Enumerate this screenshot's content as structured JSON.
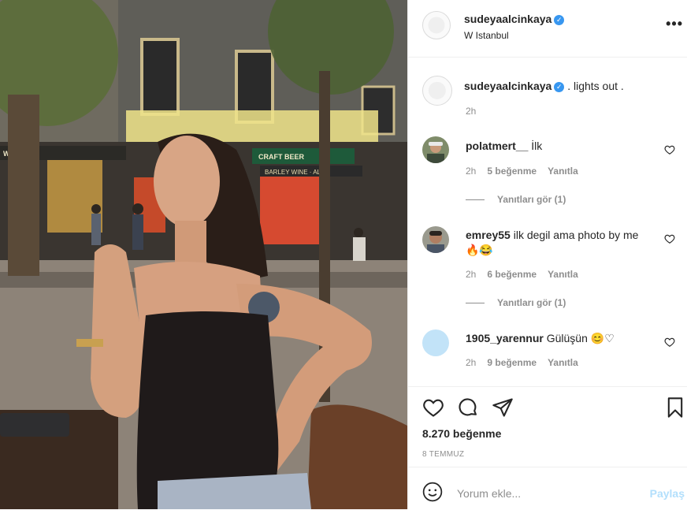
{
  "post": {
    "username": "sudeyaalcinkaya",
    "location": "W Istanbul",
    "verified_icon": "verified-badge-icon",
    "more_icon": "more-options-icon",
    "more_label": "•••"
  },
  "caption": {
    "username": "sudeyaalcinkaya",
    "text": ". lights out .",
    "time": "2h"
  },
  "photo_signs": {
    "sign1": "WEIZEN",
    "sign2": "CRAFT BEER",
    "sign3": "BARLEY WINE · ALE"
  },
  "comments": [
    {
      "username": "polatmert__",
      "text": "İlk",
      "time": "2h",
      "likes": "5 beğenme",
      "reply": "Yanıtla",
      "view_replies": "Yanıtları gör (1)"
    },
    {
      "username": "emrey55",
      "text": "ilk degil ama photo by me 🔥😂",
      "time": "2h",
      "likes": "6 beğenme",
      "reply": "Yanıtla",
      "view_replies": "Yanıtları gör (1)"
    },
    {
      "username": "1905_yarennur",
      "text": "Gülüşün 😊♡",
      "time": "2h",
      "likes": "9 beğenme",
      "reply": "Yanıtla"
    }
  ],
  "actions": {
    "likes": "8.270 beğenme",
    "date": "8 TEMMUZ",
    "icons": [
      "heart-icon",
      "comment-icon",
      "share-icon",
      "bookmark-icon"
    ]
  },
  "add_comment": {
    "placeholder": "Yorum ekle...",
    "share_label": "Paylaş",
    "emoji_icon": "emoji-icon"
  },
  "colors": {
    "verified": "#3897f0",
    "muted": "#8e8e8e",
    "share_disabled": "#b2dffc",
    "comment_avatar_3": "#c2e3f8"
  }
}
